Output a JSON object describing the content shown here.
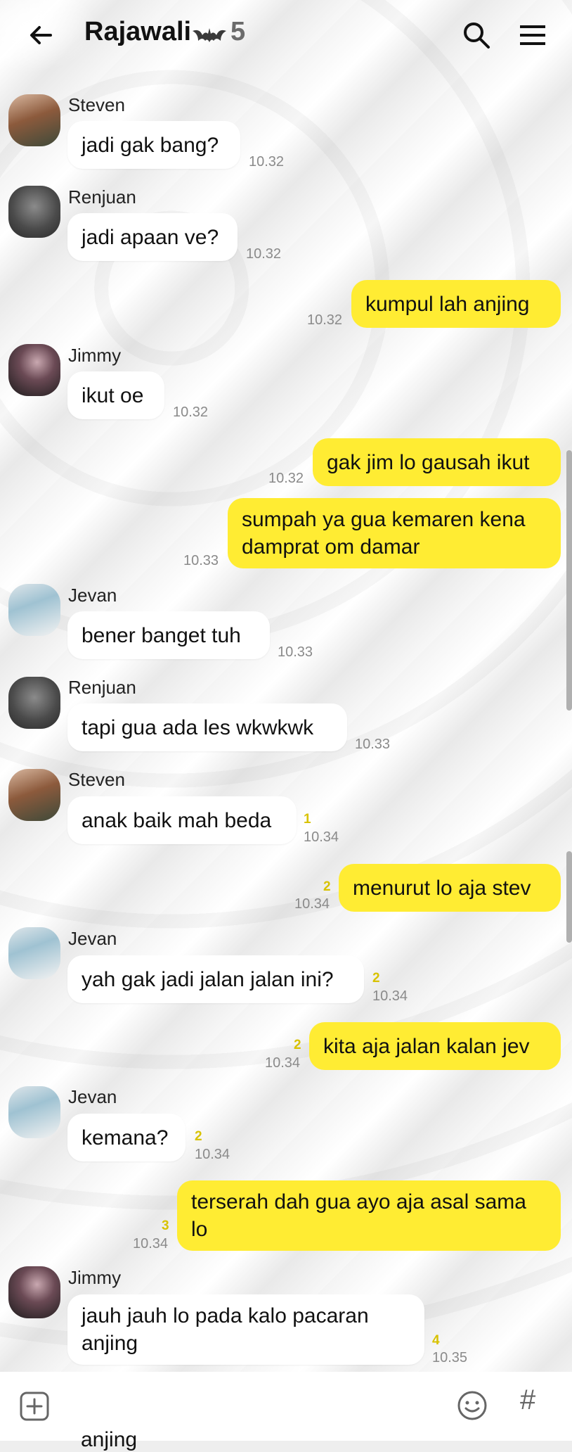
{
  "header": {
    "title": "Rajawali",
    "member_count": "5"
  },
  "messages": [
    {
      "sender": "Steven",
      "text": "jadi gak bang?",
      "time": "10.32",
      "unread": ""
    },
    {
      "sender": "Renjuan",
      "text": "jadi apaan ve?",
      "time": "10.32",
      "unread": ""
    },
    {
      "sender": "",
      "text": "kumpul lah anjing",
      "time": "10.32",
      "unread": ""
    },
    {
      "sender": "Jimmy",
      "text": "ikut oe",
      "time": "10.32",
      "unread": ""
    },
    {
      "sender": "",
      "text": "gak jim lo gausah ikut",
      "time": "10.32",
      "unread": ""
    },
    {
      "sender": "",
      "text": "sumpah ya gua kemaren kena\ndamprat om damar",
      "time": "10.33",
      "unread": ""
    },
    {
      "sender": "Jevan",
      "text": "bener banget tuh",
      "time": "10.33",
      "unread": ""
    },
    {
      "sender": "Renjuan",
      "text": "tapi gua ada les wkwkwk",
      "time": "10.33",
      "unread": ""
    },
    {
      "sender": "Steven",
      "text": "anak baik mah beda",
      "time": "10.34",
      "unread": "1"
    },
    {
      "sender": "",
      "text": "menurut lo aja stev",
      "time": "10.34",
      "unread": "2"
    },
    {
      "sender": "Jevan",
      "text": "yah gak jadi jalan jalan ini?",
      "time": "10.34",
      "unread": "2"
    },
    {
      "sender": "",
      "text": "kita aja jalan kalan jev",
      "time": "10.34",
      "unread": "2"
    },
    {
      "sender": "Jevan",
      "text": "kemana?",
      "time": "10.34",
      "unread": "2"
    },
    {
      "sender": "",
      "text": "terserah dah gua ayo aja asal sama\nlo",
      "time": "10.34",
      "unread": "3"
    },
    {
      "sender": "Jimmy",
      "text": "jauh jauh lo pada kalo pacaran\nanjing",
      "time": "10.35",
      "unread": "4"
    }
  ],
  "input": {
    "preview_text": "anjing"
  },
  "colors": {
    "outgoing_bubble": "#ffec33",
    "incoming_bubble": "#ffffff",
    "unread": "#d8c200"
  }
}
